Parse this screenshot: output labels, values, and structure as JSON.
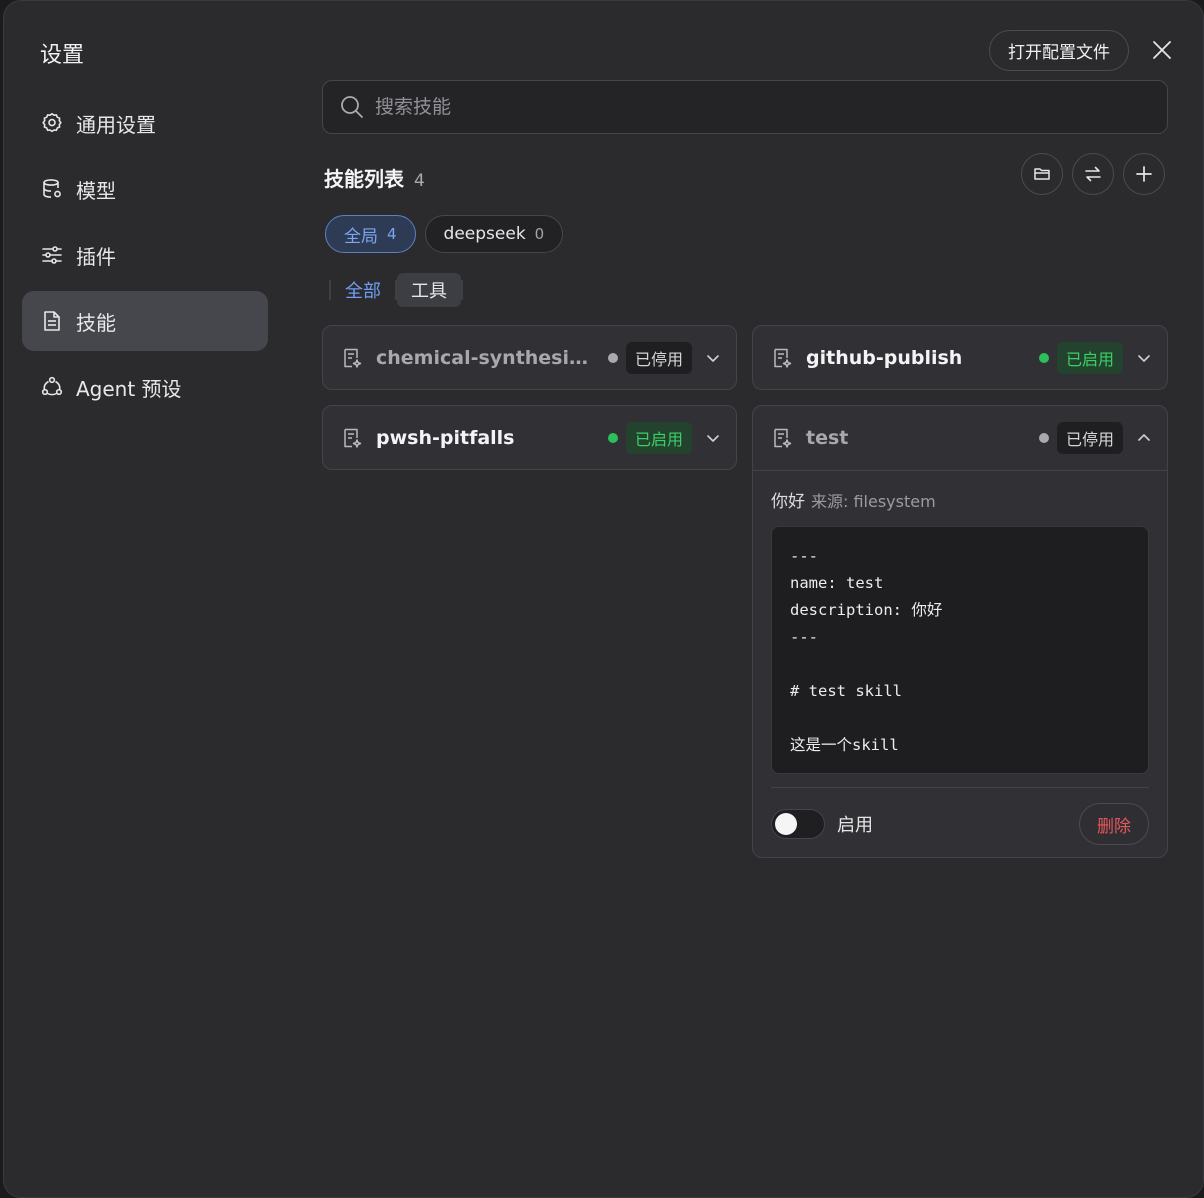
{
  "title": "设置",
  "open_config_label": "打开配置文件",
  "sidebar": {
    "items": [
      {
        "label": "通用设置",
        "icon": "gear-icon"
      },
      {
        "label": "模型",
        "icon": "database-icon"
      },
      {
        "label": "插件",
        "icon": "sliders-icon"
      },
      {
        "label": "技能",
        "icon": "document-icon",
        "active": true
      },
      {
        "label": "Agent 预设",
        "icon": "share-nodes-icon"
      }
    ]
  },
  "search": {
    "placeholder": "搜索技能",
    "value": ""
  },
  "list": {
    "heading": "技能列表",
    "count": "4"
  },
  "scopes": [
    {
      "label": "全局",
      "count": "4",
      "active": true
    },
    {
      "label": "deepseek",
      "count": "0",
      "active": false
    }
  ],
  "tabs": [
    {
      "label": "全部",
      "active": false
    },
    {
      "label": "工具",
      "active": true
    }
  ],
  "skills": [
    {
      "name": "chemical-synthesis-ro...",
      "status": "已停用",
      "enabled": false
    },
    {
      "name": "github-publish",
      "status": "已启用",
      "enabled": true
    },
    {
      "name": "pwsh-pitfalls",
      "status": "已启用",
      "enabled": true
    },
    {
      "name": "test",
      "status": "已停用",
      "enabled": false,
      "expanded": true
    }
  ],
  "detail": {
    "description": "你好",
    "source": "来源: filesystem",
    "content": "---\nname: test\ndescription: 你好\n---\n\n# test skill\n\n这是一个skill",
    "toggle_label": "启用",
    "toggle_on": false,
    "delete_label": "删除"
  },
  "colors": {
    "accent": "#6f9ff2",
    "enabled": "#2bc05a",
    "danger": "#e5565b"
  }
}
